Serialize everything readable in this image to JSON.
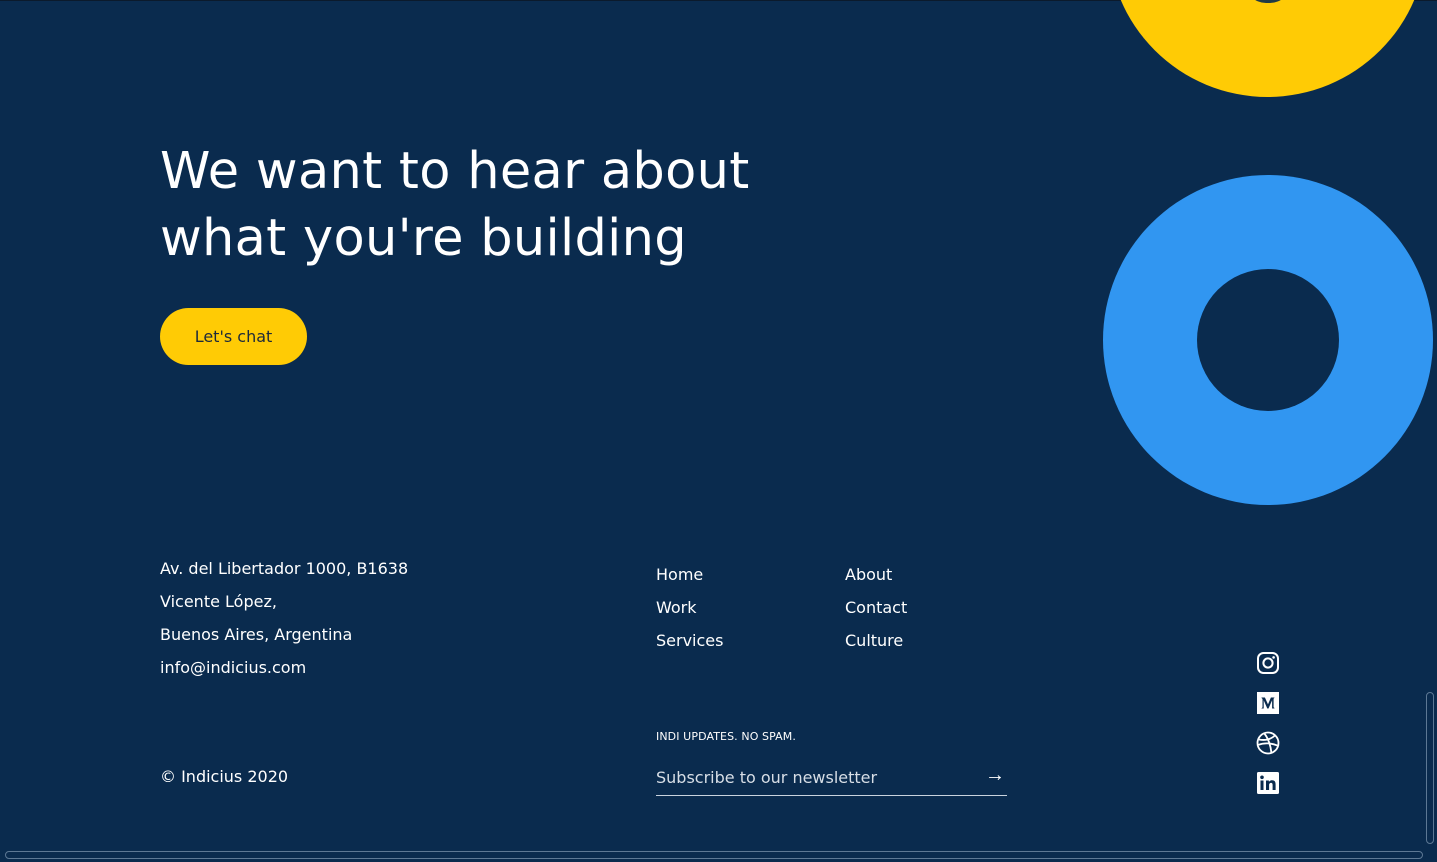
{
  "hero": {
    "headline_line1": "We want to hear about",
    "headline_line2": "what you're building",
    "cta_label": "Let's chat"
  },
  "address": {
    "line1": "Av. del Libertador 1000, B1638",
    "line2": "Vicente López,",
    "line3": "Buenos Aires, Argentina",
    "email": "info@indicius.com"
  },
  "nav": {
    "col1": [
      "Home",
      "Work",
      "Services"
    ],
    "col2": [
      "About",
      "Contact",
      "Culture"
    ]
  },
  "newsletter": {
    "label": "INDI UPDATES. NO SPAM.",
    "placeholder": "Subscribe to our newsletter",
    "submit_icon": "→"
  },
  "footer": {
    "copyright": "© Indicius 2020"
  },
  "socials": [
    "instagram-icon",
    "medium-icon",
    "dribbble-icon",
    "linkedin-icon"
  ],
  "colors": {
    "background": "#0a2b4e",
    "accent_yellow": "#ffcb05",
    "accent_blue": "#3196f1",
    "text": "#ffffff"
  }
}
